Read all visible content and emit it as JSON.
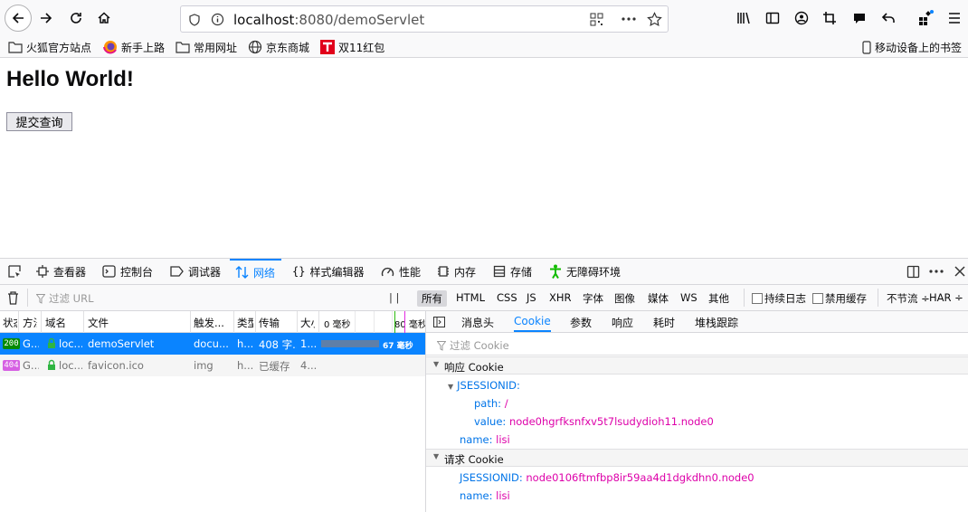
{
  "browser": {
    "url_host": "localhost",
    "url_path": ":8080/demoServlet"
  },
  "bookmarks": {
    "items": [
      "火狐官方站点",
      "新手上路",
      "常用网址",
      "京东商城",
      "双11红包"
    ],
    "mobile": "移动设备上的书签"
  },
  "page": {
    "title": "Hello World!",
    "submit_label": "提交查询"
  },
  "devtools": {
    "tabs": [
      "查看器",
      "控制台",
      "调试器",
      "网络",
      "样式编辑器",
      "性能",
      "内存",
      "存储",
      "无障碍环境"
    ],
    "selected_tab": "网络",
    "network": {
      "filter_placeholder": "过滤 URL",
      "filter_types": [
        "所有",
        "HTML",
        "CSS",
        "JS",
        "XHR",
        "字体",
        "图像",
        "媒体",
        "WS",
        "其他"
      ],
      "persist_log": "持续日志",
      "disable_cache": "禁用缓存",
      "throttle": "不节流 ÷",
      "har": "HAR ÷",
      "columns": [
        "状态",
        "方法",
        "域名",
        "文件",
        "触发...",
        "类型",
        "传输",
        "大小",
        "0 毫秒",
        "80 毫秒"
      ],
      "requests": [
        {
          "status": "200",
          "method": "G...",
          "domain": "loc...",
          "file": "demoServlet",
          "cause": "docu...",
          "type": "h...",
          "transferred": "408 字...",
          "size": "1...",
          "timing": "67 毫秒",
          "status_color": "#058b00"
        },
        {
          "status": "404",
          "method": "G...",
          "domain": "loc...",
          "file": "favicon.ico",
          "cause": "img",
          "type": "h...",
          "transferred": "已缓存",
          "size": "4...",
          "timing": "",
          "status_color": "#d660e3"
        }
      ],
      "side_tabs": [
        "消息头",
        "Cookie",
        "参数",
        "响应",
        "耗时",
        "堆栈跟踪"
      ],
      "selected_side_tab": "Cookie",
      "cookie_filter_placeholder": "过滤 Cookie",
      "response_cookie": {
        "header": "响应 Cookie",
        "name": "JSESSIONID:",
        "path_key": "path:",
        "path_val": "/",
        "value_key": "value:",
        "value_val": "node0hgrfksnfxv5t7lsudydioh11.node0",
        "name_key": "name:",
        "name_val": "lisi"
      },
      "request_cookie": {
        "header": "请求 Cookie",
        "session_key": "JSESSIONID:",
        "session_val": "node0106ftmfbp8ir59aa4d1dgkdhn0.node0",
        "name_key": "name:",
        "name_val": "lisi"
      }
    }
  }
}
